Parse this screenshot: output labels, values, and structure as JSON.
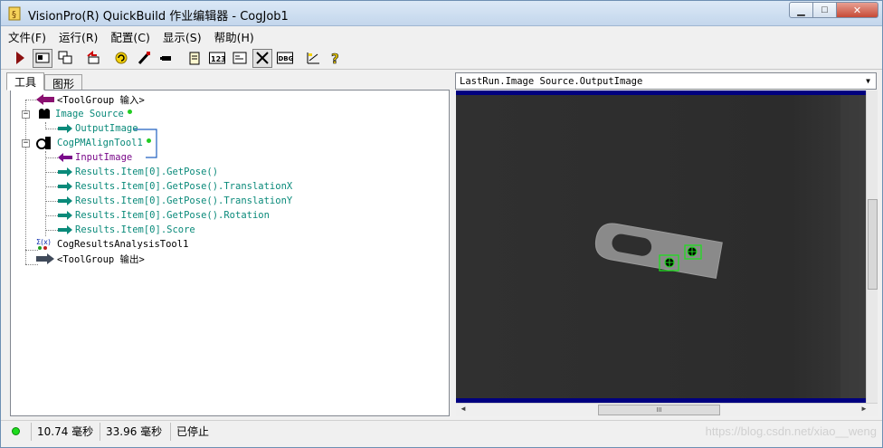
{
  "window": {
    "title": "VisionPro(R) QuickBuild 作业编辑器 - CogJob1"
  },
  "menu": [
    "文件(F)",
    "运行(R)",
    "配置(C)",
    "显示(S)",
    "帮助(H)"
  ],
  "toolbar": {
    "icons": [
      "run-icon",
      "display-mode-icon",
      "floating-windows-icon",
      "reset-icon",
      "refresh-icon",
      "edit-icon",
      "record-icon",
      "notepad-icon",
      "numeric-icon",
      "terminal-icon",
      "tools-icon",
      "debug-icon",
      "results-icon",
      "help-icon"
    ]
  },
  "tabs": {
    "tools": "工具",
    "graphics": "图形"
  },
  "tree": {
    "toolgroup_input": "<ToolGroup 输入>",
    "image_source": "Image Source",
    "output_image": "OutputImage",
    "pmalign": "CogPMAlignTool1",
    "input_image": "InputImage",
    "result_pose": "Results.Item[0].GetPose()",
    "result_tx": "Results.Item[0].GetPose().TranslationX",
    "result_ty": "Results.Item[0].GetPose().TranslationY",
    "result_rot": "Results.Item[0].GetPose().Rotation",
    "result_score": "Results.Item[0].Score",
    "results_analysis": "CogResultsAnalysisTool1",
    "toolgroup_output": "<ToolGroup 输出>"
  },
  "display": {
    "source": "LastRun.Image Source.OutputImage",
    "scroll_grip": "III"
  },
  "status": {
    "time1": "10.74 毫秒",
    "time2": "33.96 毫秒",
    "state": "已停止"
  },
  "watermark": "https://blog.csdn.net/xiao__weng"
}
